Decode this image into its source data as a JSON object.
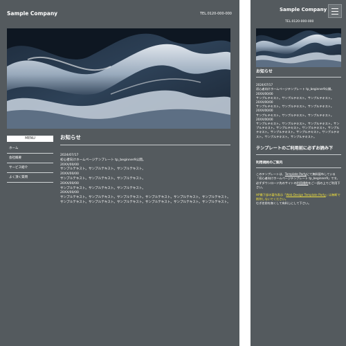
{
  "site": {
    "logo": "Sample Company",
    "tel": "TEL.0120-000-000"
  },
  "nav": {
    "menu_label": "MENU",
    "items": [
      "ホーム",
      "会社概要",
      "サービス紹介",
      "よく頂く質問"
    ]
  },
  "news": {
    "heading": "お知らせ",
    "lines": [
      "2024/07/17",
      "初心者向けホームページテンプレート tp_beginner9公開。",
      "20XX/00/00",
      "サンプルテキスト。サンプルテキスト。サンプルテキスト。",
      "20XX/00/00",
      "サンプルテキスト。サンプルテキスト。サンプルテキスト。",
      "20XX/00/00",
      "サンプルテキスト。サンプルテキスト。サンプルテキスト。",
      "20XX/00/00",
      "サンプルテキスト。サンプルテキスト。サンプルテキスト。サンプルテキスト。サンプルテキスト。サンプルテキスト。サンプルテキスト。サンプルテキスト。サンプルテキスト。サンプルテキスト。サンプルテキスト。サンプルテキスト。"
    ]
  },
  "mobile": {
    "news_lines": [
      "2024/07/17",
      "初心者向けホームページテンプレート tp_beginner9公開。",
      "20XX/00/00",
      "サンプルテキスト。サンプルテキスト。サンプルテキスト。",
      "20XX/00/00",
      "サンプルテキスト。サンプルテキスト。サンプルテキスト。",
      "20XX/00/00",
      "サンプルテキスト。サンプルテキスト。サンプルテキスト。",
      "20XX/00/00",
      "サンプルテキスト。サンプルテキスト。サンプルテキスト。サンプルテキスト。サンプルテキスト。サンプルテキスト。サンプルテキスト。サンプルテキスト。サンプルテキスト。サンプルテキスト。サンプルテキスト。サンプルテキスト。"
    ],
    "section_title": "テンプレートのご利用前に必ずお読み下",
    "sub_title": "利用規約のご案内",
    "body_pre": "このテンプレートは、",
    "body_link1": "Template Party",
    "body_mid": "にて無料配布している「初心者向けホームページテンプレート tp_beginner9」です。必ずダウンロード先のサイトの",
    "body_link2": "利用規約",
    "body_post": "をご一読の上でご利用下さい。",
    "yellow_pre": "HP最下部の著作表示「",
    "yellow_link": "Web Design Template Party",
    "yellow_post": "」は無断で削除しないでください。",
    "foot_text": "むぎ名前を無くして有料しにして下さい。"
  },
  "colors": {
    "background": "#545a5e",
    "accent_yellow": "#f3e33c"
  }
}
